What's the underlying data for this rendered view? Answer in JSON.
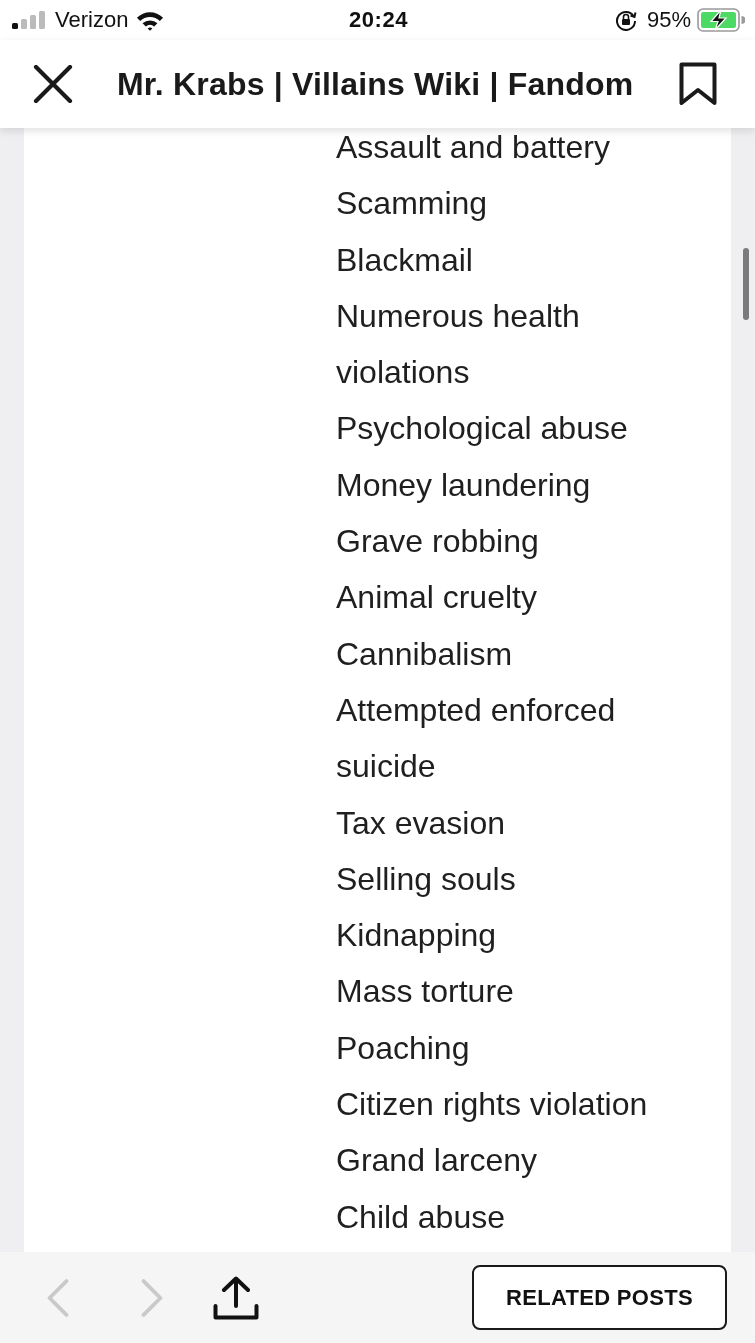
{
  "status_bar": {
    "carrier": "Verizon",
    "time": "20:24",
    "battery": "95%",
    "charging": true
  },
  "header": {
    "title": "Mr. Krabs | Villains Wiki | Fandom"
  },
  "list": {
    "items": [
      "Assault and battery",
      "Scamming",
      "Blackmail",
      "Numerous health violations",
      "Psychological abuse",
      "Money laundering",
      "Grave robbing",
      "Animal cruelty",
      "Cannibalism",
      "Attempted enforced suicide",
      "Tax evasion",
      "Selling souls",
      "Kidnapping",
      "Mass torture",
      "Poaching",
      "Citizen rights violation",
      "Grand larceny",
      "Child abuse"
    ]
  },
  "toolbar": {
    "back": {
      "disabled": true
    },
    "forward": {
      "disabled": true
    },
    "button": "RELATED POSTS"
  }
}
